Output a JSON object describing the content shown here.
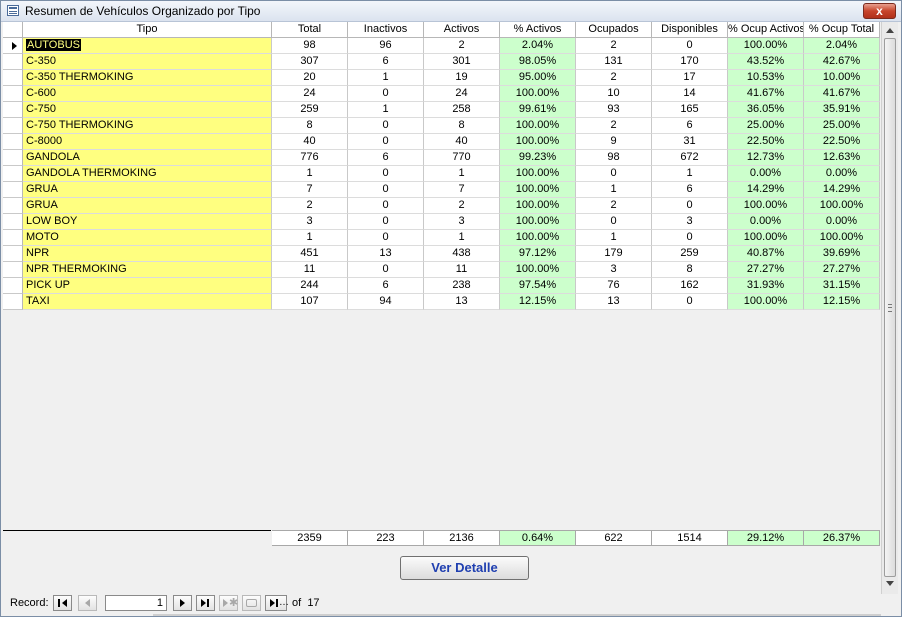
{
  "window": {
    "title": "Resumen de Vehículos Organizado por Tipo",
    "close_glyph": "x"
  },
  "columns": [
    "Tipo",
    "Total",
    "Inactivos",
    "Activos",
    "% Activos",
    "Ocupados",
    "Disponibles",
    "% Ocup Activos",
    "% Ocup Total"
  ],
  "rows": [
    [
      "AUTOBUS",
      "98",
      "96",
      "2",
      "2.04%",
      "2",
      "0",
      "100.00%",
      "2.04%"
    ],
    [
      "C-350",
      "307",
      "6",
      "301",
      "98.05%",
      "131",
      "170",
      "43.52%",
      "42.67%"
    ],
    [
      "C-350 THERMOKING",
      "20",
      "1",
      "19",
      "95.00%",
      "2",
      "17",
      "10.53%",
      "10.00%"
    ],
    [
      "C-600",
      "24",
      "0",
      "24",
      "100.00%",
      "10",
      "14",
      "41.67%",
      "41.67%"
    ],
    [
      "C-750",
      "259",
      "1",
      "258",
      "99.61%",
      "93",
      "165",
      "36.05%",
      "35.91%"
    ],
    [
      "C-750 THERMOKING",
      "8",
      "0",
      "8",
      "100.00%",
      "2",
      "6",
      "25.00%",
      "25.00%"
    ],
    [
      "C-8000",
      "40",
      "0",
      "40",
      "100.00%",
      "9",
      "31",
      "22.50%",
      "22.50%"
    ],
    [
      "GANDOLA",
      "776",
      "6",
      "770",
      "99.23%",
      "98",
      "672",
      "12.73%",
      "12.63%"
    ],
    [
      "GANDOLA THERMOKING",
      "1",
      "0",
      "1",
      "100.00%",
      "0",
      "1",
      "0.00%",
      "0.00%"
    ],
    [
      "GRUA",
      "7",
      "0",
      "7",
      "100.00%",
      "1",
      "6",
      "14.29%",
      "14.29%"
    ],
    [
      "GRUA",
      "2",
      "0",
      "2",
      "100.00%",
      "2",
      "0",
      "100.00%",
      "100.00%"
    ],
    [
      "LOW BOY",
      "3",
      "0",
      "3",
      "100.00%",
      "0",
      "3",
      "0.00%",
      "0.00%"
    ],
    [
      "MOTO",
      "1",
      "0",
      "1",
      "100.00%",
      "1",
      "0",
      "100.00%",
      "100.00%"
    ],
    [
      "NPR",
      "451",
      "13",
      "438",
      "97.12%",
      "179",
      "259",
      "40.87%",
      "39.69%"
    ],
    [
      "NPR THERMOKING",
      "11",
      "0",
      "11",
      "100.00%",
      "3",
      "8",
      "27.27%",
      "27.27%"
    ],
    [
      "PICK UP",
      "244",
      "6",
      "238",
      "97.54%",
      "76",
      "162",
      "31.93%",
      "31.15%"
    ],
    [
      "TAXI",
      "107",
      "94",
      "13",
      "12.15%",
      "13",
      "0",
      "100.00%",
      "12.15%"
    ]
  ],
  "footer": [
    "2359",
    "223",
    "2136",
    "0.64%",
    "622",
    "1514",
    "29.12%",
    "26.37%"
  ],
  "detail_button": {
    "label": "Ver Detalle"
  },
  "navigator": {
    "label": "Record:",
    "current": "1",
    "of_label": "of",
    "total": "17"
  },
  "colors": {
    "tipo_bg": "#ffff80",
    "percent_bg": "#ccffcc",
    "cell_bg": "#ffffff"
  }
}
